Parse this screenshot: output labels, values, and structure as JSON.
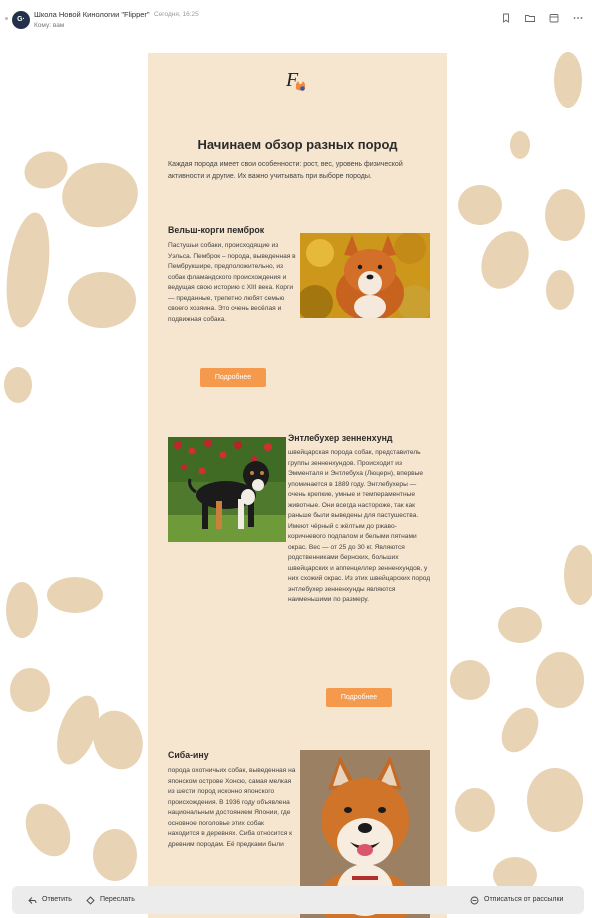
{
  "header": {
    "avatar_initials": "G·",
    "sender": "Школа Новой Кинологии \"Flipper\"",
    "time": "Сегодня, 16:25",
    "to_label": "Кому:",
    "to_value": "вам"
  },
  "email": {
    "title": "Начинаем обзор разных пород",
    "intro": "Каждая порода имеет свои особенности: рост, вес, уровень физической активности и другие. Их важно учитывать при выборе породы.",
    "breeds": [
      {
        "title": "Вельш-корги пемброк",
        "text": "Пастушьи собаки, происходящие из Уэльса. Пемброк – порода, выведенная в Пембрукшире, предположительно, из собак фламандского происхождения и ведущая свою историю с XIII века. Корги — преданные, трепетно любят семью своего хозяина. Это очень весёлая и подвижная собака.",
        "button": "Подробнее"
      },
      {
        "title": "Энтлебухер зенненхунд",
        "text": " швейцарская порода собак, представитель группы зенненхундов. Происходит из Эмменталя и Энтлебуха (Люцерн), впервые упоминается в 1889 году. Энтлебухеры — очень крепкие, умные и темпераментные животные. Они всегда настороже, так как раньше были выведены для пастушества. Имеют чёрный с жёлтым до ржаво-коричневого подпалом и белыми пятнами окрас. Вес — от 25 до 30 кг. Являются родственниками бернских, больших швейцарских и аппенцеллер зенненхундов, у них схожий окрас. Из этих швейцарских пород энтлебухер зенненхунды являются наименьшими по размеру.",
        "button": "Подробнее"
      },
      {
        "title": "Сиба-ину",
        "text": " порода охотничьих собак, выведенная на японском острове Хонсю, самая мелкая из шести пород исконно японского происхождения. В 1936 году объявлена национальным достоянием Японии, где основное поголовье этих собак находится в деревнях. Сиба относится к древним породам. Её предками были"
      }
    ]
  },
  "actions": {
    "reply": "Ответить",
    "forward": "Переслать",
    "unsubscribe": "Отписаться от рассылки"
  },
  "colors": {
    "card_bg": "#f6e6cf",
    "button": "#f59a4c",
    "paw": "#e8d3b4"
  }
}
